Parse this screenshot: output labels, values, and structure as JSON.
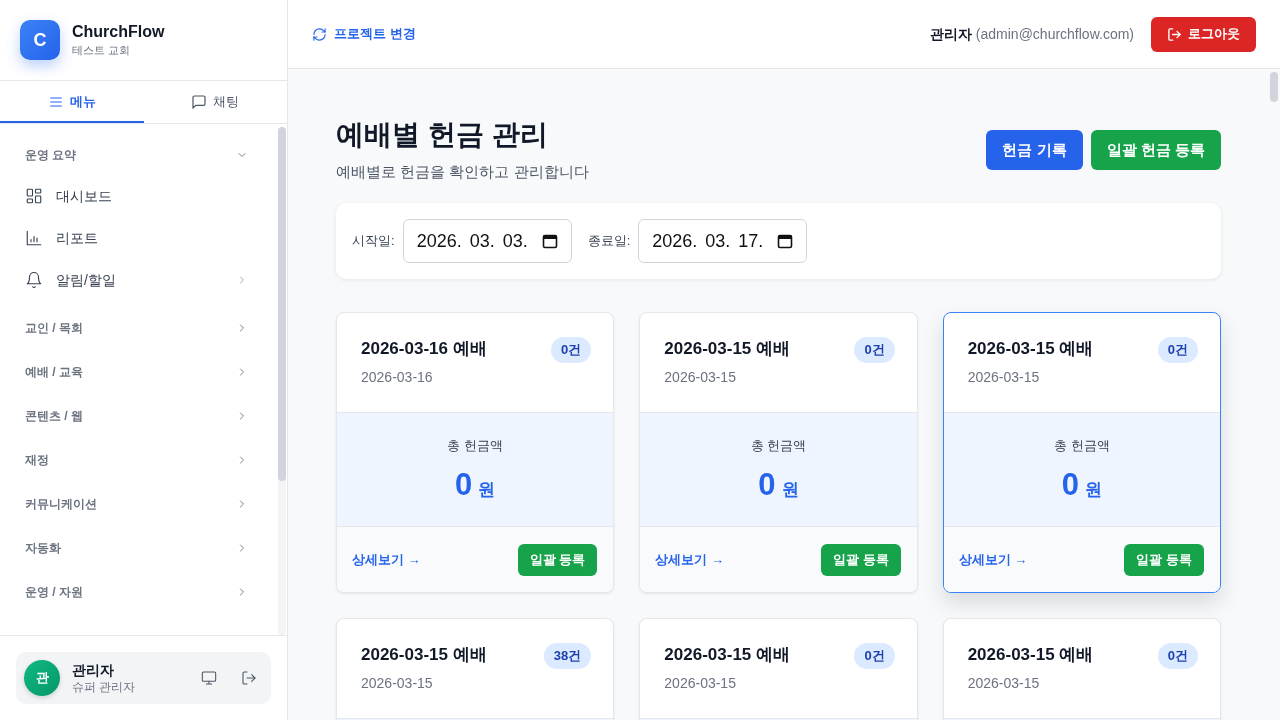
{
  "sidebar": {
    "brand": {
      "logo": "C",
      "name": "ChurchFlow",
      "subtitle": "테스트 교회"
    },
    "tabs": [
      {
        "label": "메뉴",
        "selected": true
      },
      {
        "label": "채팅",
        "selected": false
      }
    ],
    "sections": [
      {
        "label": "운영 요약",
        "expanded": true,
        "items": [
          {
            "label": "대시보드",
            "kind": "link"
          },
          {
            "label": "리포트",
            "kind": "link"
          },
          {
            "label": "알림/할일",
            "kind": "submenu",
            "expanded": false
          }
        ]
      },
      {
        "label": "교인 / 목회",
        "expanded": false
      },
      {
        "label": "예배 / 교육",
        "expanded": false
      },
      {
        "label": "콘텐츠 / 웹",
        "expanded": false
      },
      {
        "label": "재정",
        "expanded": false
      },
      {
        "label": "커뮤니케이션",
        "expanded": false
      },
      {
        "label": "자동화",
        "expanded": false
      },
      {
        "label": "운영 / 자원",
        "expanded": false
      }
    ],
    "user": {
      "avatar": "관",
      "name": "관리자",
      "role": "슈퍼 관리자"
    }
  },
  "topbar": {
    "project_switch": "프로젝트 변경",
    "user_name": "관리자",
    "user_email": "(admin@churchflow.com)",
    "logout_button": "로그아웃"
  },
  "page": {
    "title": "예배별 헌금 관리",
    "subtitle": "예배별로 헌금을 확인하고 관리합니다",
    "buttons": [
      {
        "label": "헌금 기록",
        "kind": "primary"
      },
      {
        "label": "일괄 헌금 등록",
        "kind": "success"
      }
    ]
  },
  "filters": [
    {
      "label": "시작일:",
      "value": "2026. 03. 03."
    },
    {
      "label": "종료일:",
      "value": "2026. 03. 17."
    }
  ],
  "cards": [
    {
      "title": "2026-03-16 예배",
      "date": "2026-03-16",
      "count": "0건",
      "total_label": "총 헌금액",
      "amount": "0",
      "unit": "원",
      "detail_link": "상세보기 →",
      "action": "일괄 등록",
      "hovered": false
    },
    {
      "title": "2026-03-15 예배",
      "date": "2026-03-15",
      "count": "0건",
      "total_label": "총 헌금액",
      "amount": "0",
      "unit": "원",
      "detail_link": "상세보기 →",
      "action": "일괄 등록",
      "hovered": false
    },
    {
      "title": "2026-03-15 예배",
      "date": "2026-03-15",
      "count": "0건",
      "total_label": "총 헌금액",
      "amount": "0",
      "unit": "원",
      "detail_link": "상세보기 →",
      "action": "일괄 등록",
      "hovered": true
    },
    {
      "title": "2026-03-15 예배",
      "date": "2026-03-15",
      "count": "38건",
      "hovered": false
    },
    {
      "title": "2026-03-15 예배",
      "date": "2026-03-15",
      "count": "0건",
      "hovered": false
    },
    {
      "title": "2026-03-15 예배",
      "date": "2026-03-15",
      "count": "0건",
      "hovered": false
    }
  ]
}
